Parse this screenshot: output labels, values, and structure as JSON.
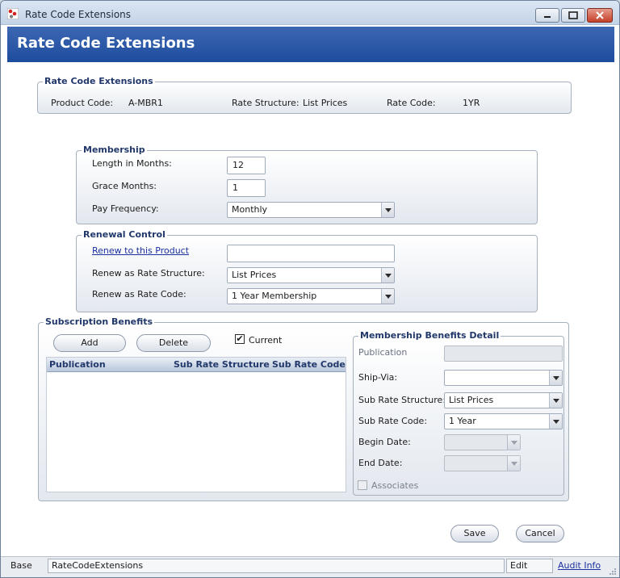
{
  "window": {
    "title": "Rate Code Extensions"
  },
  "header": {
    "title": "Rate Code Extensions"
  },
  "rate_code_group": {
    "title": "Rate Code Extensions",
    "product_code_label": "Product Code:",
    "product_code_value": "A-MBR1",
    "rate_structure_label": "Rate Structure:",
    "rate_structure_value": "List Prices",
    "rate_code_label": "Rate Code:",
    "rate_code_value": "1YR"
  },
  "membership": {
    "title": "Membership",
    "length_label": "Length in Months:",
    "length_value": "12",
    "grace_label": "Grace Months:",
    "grace_value": "1",
    "pay_freq_label": "Pay Frequency:",
    "pay_freq_value": "Monthly"
  },
  "renewal": {
    "title": "Renewal Control",
    "renew_product_label": "Renew to this Product",
    "renew_product_value": "",
    "renew_rate_structure_label": "Renew as Rate Structure:",
    "renew_rate_structure_value": "List Prices",
    "renew_rate_code_label": "Renew as Rate Code:",
    "renew_rate_code_value": "1 Year Membership"
  },
  "subscription": {
    "title": "Subscription Benefits",
    "add_label": "Add",
    "delete_label": "Delete",
    "current_label": "Current",
    "current_checked": "✔",
    "columns": [
      "Publication",
      "Sub Rate Structure",
      "Sub Rate Code"
    ]
  },
  "benefits_detail": {
    "title": "Membership Benefits Detail",
    "publication_label": "Publication",
    "publication_value": "",
    "ship_via_label": "Ship-Via:",
    "ship_via_value": "",
    "sub_rate_structure_label": "Sub Rate Structure:",
    "sub_rate_structure_value": "List Prices",
    "sub_rate_code_label": "Sub Rate Code:",
    "sub_rate_code_value": "1 Year",
    "begin_date_label": "Begin Date:",
    "begin_date_value": "",
    "end_date_label": "End Date:",
    "end_date_value": "",
    "associates_label": "Associates"
  },
  "actions": {
    "save_label": "Save",
    "cancel_label": "Cancel"
  },
  "statusbar": {
    "base_label": "Base",
    "form_name": "RateCodeExtensions",
    "mode": "Edit",
    "audit_info": "Audit Info"
  },
  "colors": {
    "header_band": "#2a57a8",
    "group_title": "#21386b",
    "link": "#1a2fa0"
  }
}
